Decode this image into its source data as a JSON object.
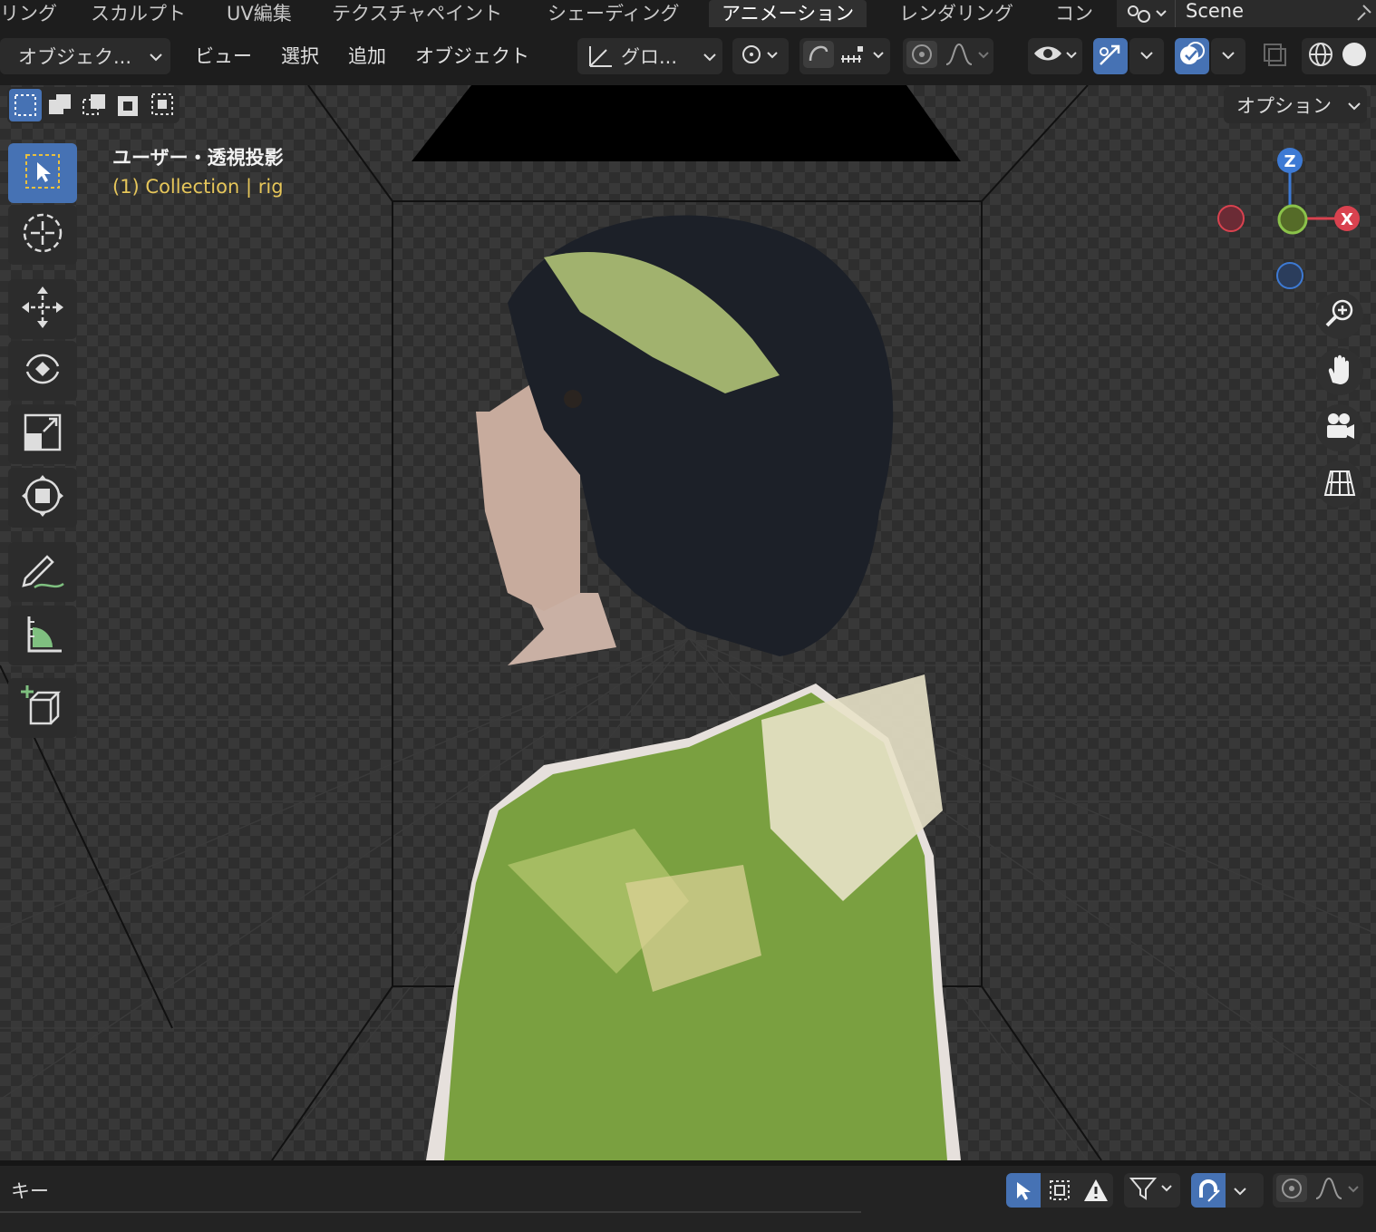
{
  "workspace_tabs": [
    "リング",
    "スカルプト",
    "UV編集",
    "テクスチャペイント",
    "シェーディング",
    "アニメーション",
    "レンダリング",
    "コン"
  ],
  "active_tab": "アニメーション",
  "scene": {
    "name": "Scene"
  },
  "header": {
    "mode": "オブジェク...",
    "menus": [
      "ビュー",
      "選択",
      "追加",
      "オブジェクト"
    ],
    "transform_orientation": "グロ...",
    "options": "オプション"
  },
  "viewport": {
    "view_label": "ユーザー・透視投影",
    "collection_label": "(1) Collection | rig"
  },
  "gizmo": {
    "z": "Z",
    "x": "X"
  },
  "bottom": {
    "key_label": "キー"
  },
  "colors": {
    "accent": "#4672b4",
    "header_bg": "#1d1d1d",
    "viewport_bg": "#2e2e2e",
    "label_yellow": "#e6c65a",
    "axis_x": "#d9424f",
    "axis_y": "#73a33a",
    "axis_z": "#3d7ad4"
  },
  "icons": [
    "select-box-icon",
    "cursor-icon",
    "move-icon",
    "rotate-icon",
    "scale-icon",
    "transform-icon",
    "annotate-icon",
    "measure-icon",
    "add-cube-icon",
    "zoom-icon",
    "hand-pan-icon",
    "camera-icon",
    "grid-ortho-icon"
  ]
}
